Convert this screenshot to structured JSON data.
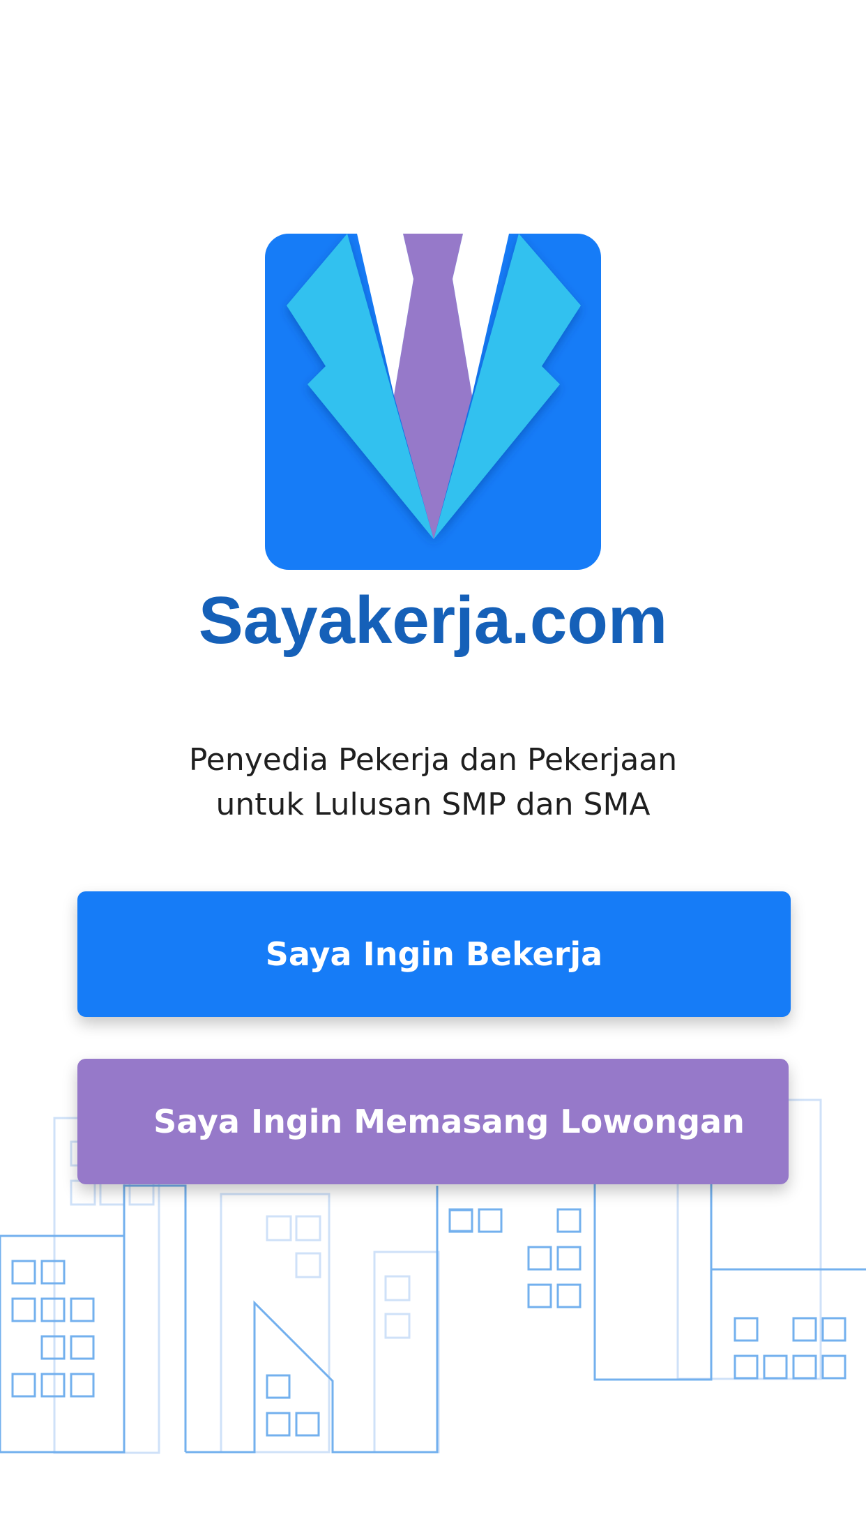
{
  "brand": {
    "name": "Sayakerja.com",
    "logo_icon": "suit-tie-icon",
    "colors": {
      "logo_background": "#167cf7",
      "lapel": "#33c1ef",
      "tie": "#9679c9",
      "brand_text": "#1560b8"
    }
  },
  "tagline": {
    "line1": "Penyedia Pekerja dan Pekerjaan",
    "line2": "untuk Lulusan SMP dan SMA"
  },
  "actions": {
    "work_label": "Saya Ingin Bekerja",
    "work_color": "#167cf7",
    "post_label": "Saya Ingin Memasang Lowongan",
    "post_color": "#9679c9"
  },
  "background": {
    "illustration_icon": "city-skyline-icon"
  }
}
